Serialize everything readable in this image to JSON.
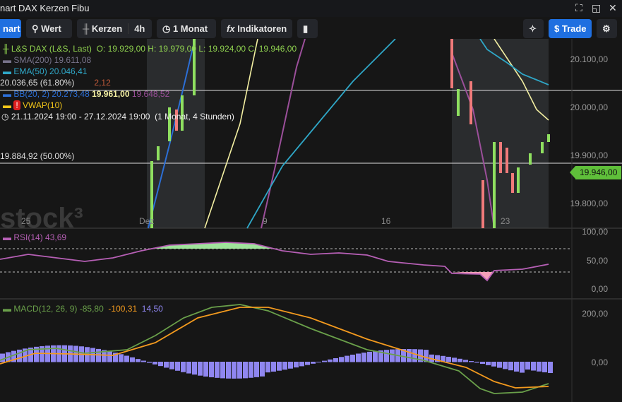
{
  "window": {
    "title": "nart DAX Kerzen Fibu"
  },
  "toolbar": {
    "chart": "nart",
    "search": "Wert",
    "type": "Kerzen",
    "interval": "4h",
    "range": "1 Monat",
    "indicators": "Indikatoren",
    "trade": "$ Trade"
  },
  "legend": {
    "instrument": "L&S DAX (L&S, Last)",
    "ohlc": "O: 19.929,00  H: 19.979,00  L: 19.924,00  C: 19.946,00",
    "sma": "SMA(200)",
    "sma_val": "19.611,08",
    "ema": "EMA(50)",
    "ema_val": "20.046,41",
    "fib_overlap": "20.036,65 (61.80%)",
    "hidden_val": "2,12",
    "bb": "BB(20, 2)",
    "bb_upper": "20.273,48",
    "bb_mid": "19.961,00",
    "bb_lower": "19.648,52",
    "vwap": "VWAP(10)",
    "range": "21.11.2024 19:00 - 27.12.2024 19:00",
    "range_detail": "(1 Monat, 4 Stunden)",
    "fib50": "19.884,92 (50.00%)"
  },
  "watermark": "stock3",
  "price_axis": [
    "20.100,00",
    "20.000,00",
    "19.900,00",
    "19.800,00"
  ],
  "last_price": "19.946,00",
  "x_axis": [
    "25",
    "Dez",
    "9",
    "16",
    "23"
  ],
  "rsi": {
    "label": "RSI(14)",
    "value": "43,69",
    "axis": [
      "100,00",
      "50,00",
      "0,00"
    ]
  },
  "macd": {
    "label": "MACD(12, 26, 9)",
    "macd": "-85,80",
    "signal": "-100,31",
    "hist": "14,50",
    "axis": [
      "200,00",
      "0,00"
    ]
  },
  "colors": {
    "up": "#8fe060",
    "down": "#f07a7a",
    "accent": "#1f6fe0"
  }
}
